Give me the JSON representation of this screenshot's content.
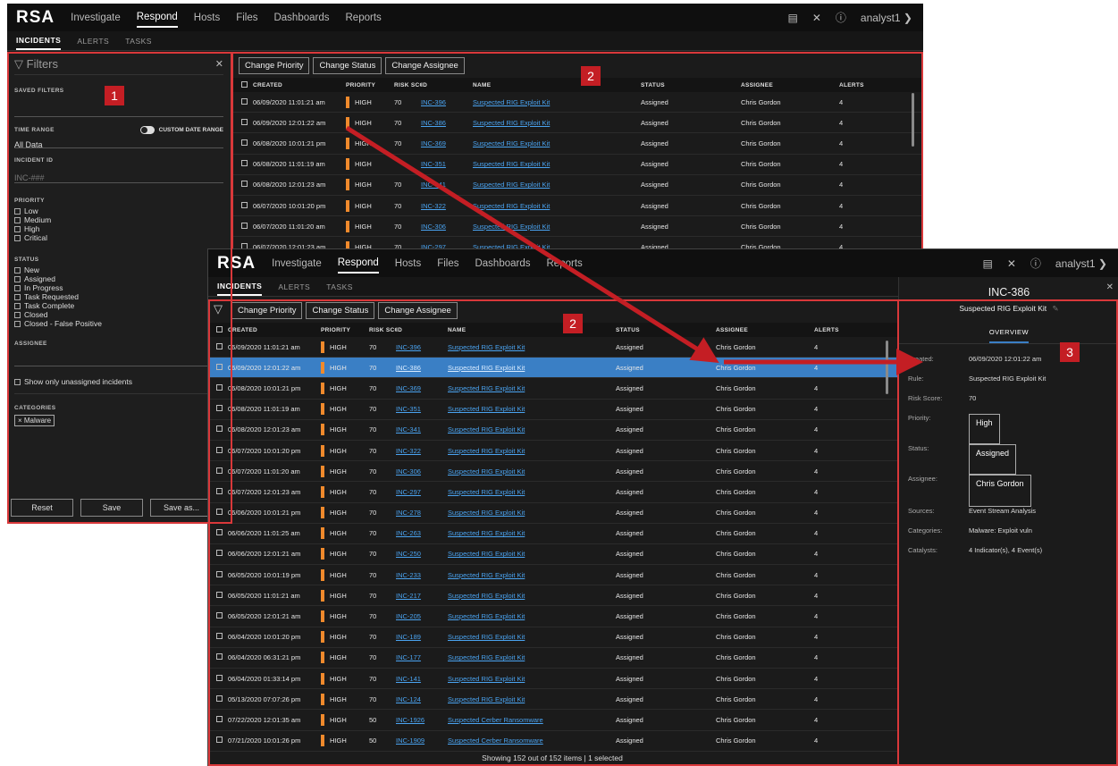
{
  "app": {
    "logo": "RSA",
    "nav": [
      "Investigate",
      "Respond",
      "Hosts",
      "Files",
      "Dashboards",
      "Reports"
    ],
    "active_nav": "Respond",
    "user": "analyst1 ❯",
    "subtabs": [
      "INCIDENTS",
      "ALERTS",
      "TASKS"
    ]
  },
  "badges": [
    "1",
    "2",
    "2",
    "3"
  ],
  "colors": {
    "priority_bar": "#f08a2c",
    "selection": "#3a7fc5",
    "callout": "#d9383a",
    "link": "#4aa3f0"
  },
  "filters": {
    "title": "Filters",
    "saved_filters_label": "SAVED FILTERS",
    "time_range_label": "TIME RANGE",
    "custom_date_label": "CUSTOM DATE RANGE",
    "time_range_value": "All Data",
    "incident_id_label": "INCIDENT ID",
    "incident_id_placeholder": "INC-###",
    "priority_label": "PRIORITY",
    "priority_options": [
      "Low",
      "Medium",
      "High",
      "Critical"
    ],
    "status_label": "STATUS",
    "status_options": [
      "New",
      "Assigned",
      "In Progress",
      "Task Requested",
      "Task Complete",
      "Closed",
      "Closed - False Positive"
    ],
    "assignee_label": "ASSIGNEE",
    "unassigned_label": "Show only unassigned incidents",
    "categories_label": "CATEGORIES",
    "category_pill": "× Malware",
    "reset": "Reset",
    "save": "Save",
    "save_as": "Save as..."
  },
  "toolbar": {
    "change_priority": "Change Priority",
    "change_status": "Change Status",
    "change_assignee": "Change Assignee"
  },
  "columns": {
    "created": "CREATED",
    "priority": "PRIORITY",
    "risk": "RISK SCORE",
    "id": "ID",
    "name": "NAME",
    "status": "STATUS",
    "assignee": "ASSIGNEE",
    "alerts": "ALERTS"
  },
  "rows_top": [
    {
      "created": "06/09/2020 11:01:21 am",
      "priority": "HIGH",
      "risk": "70",
      "id": "INC-396",
      "name": "Suspected RIG Exploit Kit",
      "status": "Assigned",
      "assignee": "Chris Gordon",
      "alerts": "4"
    },
    {
      "created": "06/09/2020 12:01:22 am",
      "priority": "HIGH",
      "risk": "70",
      "id": "INC-386",
      "name": "Suspected RIG Exploit Kit",
      "status": "Assigned",
      "assignee": "Chris Gordon",
      "alerts": "4"
    },
    {
      "created": "06/08/2020 10:01:21 pm",
      "priority": "HIGH",
      "risk": "70",
      "id": "INC-369",
      "name": "Suspected RIG Exploit Kit",
      "status": "Assigned",
      "assignee": "Chris Gordon",
      "alerts": "4"
    },
    {
      "created": "06/08/2020 11:01:19 am",
      "priority": "HIGH",
      "risk": "",
      "id": "INC-351",
      "name": "Suspected RIG Exploit Kit",
      "status": "Assigned",
      "assignee": "Chris Gordon",
      "alerts": "4"
    },
    {
      "created": "06/08/2020 12:01:23 am",
      "priority": "HIGH",
      "risk": "70",
      "id": "INC-341",
      "name": "Suspected RIG Exploit Kit",
      "status": "Assigned",
      "assignee": "Chris Gordon",
      "alerts": "4"
    },
    {
      "created": "06/07/2020 10:01:20 pm",
      "priority": "HIGH",
      "risk": "70",
      "id": "INC-322",
      "name": "Suspected RIG Exploit Kit",
      "status": "Assigned",
      "assignee": "Chris Gordon",
      "alerts": "4"
    },
    {
      "created": "06/07/2020 11:01:20 am",
      "priority": "HIGH",
      "risk": "70",
      "id": "INC-306",
      "name": "Suspected RIG Exploit Kit",
      "status": "Assigned",
      "assignee": "Chris Gordon",
      "alerts": "4"
    },
    {
      "created": "06/07/2020 12:01:23 am",
      "priority": "HIGH",
      "risk": "70",
      "id": "INC-297",
      "name": "Suspected RIG Exploit Kit",
      "status": "Assigned",
      "assignee": "Chris Gordon",
      "alerts": "4"
    }
  ],
  "rows": [
    {
      "created": "06/09/2020 11:01:21 am",
      "priority": "HIGH",
      "risk": "70",
      "id": "INC-396",
      "name": "Suspected RIG Exploit Kit",
      "status": "Assigned",
      "assignee": "Chris Gordon",
      "alerts": "4"
    },
    {
      "created": "06/09/2020 12:01:22 am",
      "priority": "HIGH",
      "risk": "70",
      "id": "INC-386",
      "name": "Suspected RIG Exploit Kit",
      "status": "Assigned",
      "assignee": "Chris Gordon",
      "alerts": "4"
    },
    {
      "created": "06/08/2020 10:01:21 pm",
      "priority": "HIGH",
      "risk": "70",
      "id": "INC-369",
      "name": "Suspected RIG Exploit Kit",
      "status": "Assigned",
      "assignee": "Chris Gordon",
      "alerts": "4"
    },
    {
      "created": "06/08/2020 11:01:19 am",
      "priority": "HIGH",
      "risk": "70",
      "id": "INC-351",
      "name": "Suspected RIG Exploit Kit",
      "status": "Assigned",
      "assignee": "Chris Gordon",
      "alerts": "4"
    },
    {
      "created": "06/08/2020 12:01:23 am",
      "priority": "HIGH",
      "risk": "70",
      "id": "INC-341",
      "name": "Suspected RIG Exploit Kit",
      "status": "Assigned",
      "assignee": "Chris Gordon",
      "alerts": "4"
    },
    {
      "created": "06/07/2020 10:01:20 pm",
      "priority": "HIGH",
      "risk": "70",
      "id": "INC-322",
      "name": "Suspected RIG Exploit Kit",
      "status": "Assigned",
      "assignee": "Chris Gordon",
      "alerts": "4"
    },
    {
      "created": "06/07/2020 11:01:20 am",
      "priority": "HIGH",
      "risk": "70",
      "id": "INC-306",
      "name": "Suspected RIG Exploit Kit",
      "status": "Assigned",
      "assignee": "Chris Gordon",
      "alerts": "4"
    },
    {
      "created": "06/07/2020 12:01:23 am",
      "priority": "HIGH",
      "risk": "70",
      "id": "INC-297",
      "name": "Suspected RIG Exploit Kit",
      "status": "Assigned",
      "assignee": "Chris Gordon",
      "alerts": "4"
    },
    {
      "created": "06/06/2020 10:01:21 pm",
      "priority": "HIGH",
      "risk": "70",
      "id": "INC-278",
      "name": "Suspected RIG Exploit Kit",
      "status": "Assigned",
      "assignee": "Chris Gordon",
      "alerts": "4"
    },
    {
      "created": "06/06/2020 11:01:25 am",
      "priority": "HIGH",
      "risk": "70",
      "id": "INC-263",
      "name": "Suspected RIG Exploit Kit",
      "status": "Assigned",
      "assignee": "Chris Gordon",
      "alerts": "4"
    },
    {
      "created": "06/06/2020 12:01:21 am",
      "priority": "HIGH",
      "risk": "70",
      "id": "INC-250",
      "name": "Suspected RIG Exploit Kit",
      "status": "Assigned",
      "assignee": "Chris Gordon",
      "alerts": "4"
    },
    {
      "created": "06/05/2020 10:01:19 pm",
      "priority": "HIGH",
      "risk": "70",
      "id": "INC-233",
      "name": "Suspected RIG Exploit Kit",
      "status": "Assigned",
      "assignee": "Chris Gordon",
      "alerts": "4"
    },
    {
      "created": "06/05/2020 11:01:21 am",
      "priority": "HIGH",
      "risk": "70",
      "id": "INC-217",
      "name": "Suspected RIG Exploit Kit",
      "status": "Assigned",
      "assignee": "Chris Gordon",
      "alerts": "4"
    },
    {
      "created": "06/05/2020 12:01:21 am",
      "priority": "HIGH",
      "risk": "70",
      "id": "INC-205",
      "name": "Suspected RIG Exploit Kit",
      "status": "Assigned",
      "assignee": "Chris Gordon",
      "alerts": "4"
    },
    {
      "created": "06/04/2020 10:01:20 pm",
      "priority": "HIGH",
      "risk": "70",
      "id": "INC-189",
      "name": "Suspected RIG Exploit Kit",
      "status": "Assigned",
      "assignee": "Chris Gordon",
      "alerts": "4"
    },
    {
      "created": "06/04/2020 06:31:21 pm",
      "priority": "HIGH",
      "risk": "70",
      "id": "INC-177",
      "name": "Suspected RIG Exploit Kit",
      "status": "Assigned",
      "assignee": "Chris Gordon",
      "alerts": "4"
    },
    {
      "created": "06/04/2020 01:33:14 pm",
      "priority": "HIGH",
      "risk": "70",
      "id": "INC-141",
      "name": "Suspected RIG Exploit Kit",
      "status": "Assigned",
      "assignee": "Chris Gordon",
      "alerts": "4"
    },
    {
      "created": "05/13/2020 07:07:26 pm",
      "priority": "HIGH",
      "risk": "70",
      "id": "INC-124",
      "name": "Suspected RIG Exploit Kit",
      "status": "Assigned",
      "assignee": "Chris Gordon",
      "alerts": "4"
    },
    {
      "created": "07/22/2020 12:01:35 am",
      "priority": "HIGH",
      "risk": "50",
      "id": "INC-1926",
      "name": "Suspected Cerber Ransomware",
      "status": "Assigned",
      "assignee": "Chris Gordon",
      "alerts": "4"
    },
    {
      "created": "07/21/2020 10:01:26 pm",
      "priority": "HIGH",
      "risk": "50",
      "id": "INC-1909",
      "name": "Suspected Cerber Ransomware",
      "status": "Assigned",
      "assignee": "Chris Gordon",
      "alerts": "4"
    }
  ],
  "footer": "Showing 152 out of 152 items  |  1 selected",
  "overview": {
    "id": "INC-386",
    "name": "Suspected RIG Exploit Kit",
    "tab": "OVERVIEW",
    "created_label": "Created:",
    "created": "06/09/2020 12:01:22 am",
    "rule_label": "Rule:",
    "rule": "Suspected RIG Exploit Kit",
    "risk_label": "Risk Score:",
    "risk": "70",
    "priority_label": "Priority:",
    "priority": "High",
    "status_label": "Status:",
    "status": "Assigned",
    "assignee_label": "Assignee:",
    "assignee": "Chris Gordon",
    "sources_label": "Sources:",
    "sources": "Event Stream Analysis",
    "categories_label": "Categories:",
    "categories": "Malware:  Exploit vuln",
    "catalysts_label": "Catalysts:",
    "catalysts": "4 Indicator(s), 4 Event(s)"
  }
}
